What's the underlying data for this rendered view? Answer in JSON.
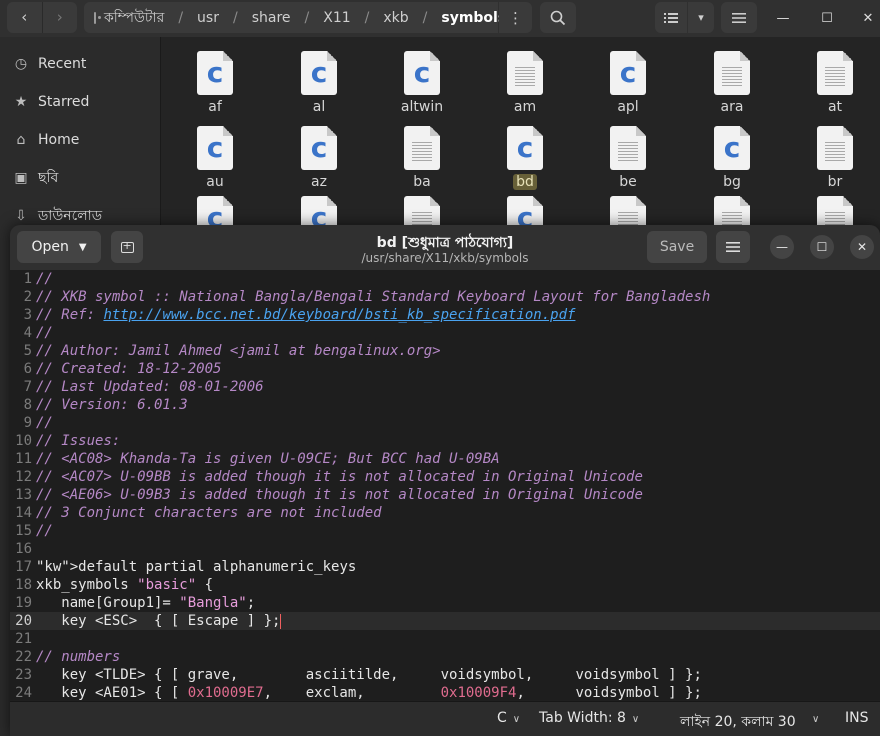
{
  "file_manager": {
    "path": [
      "কম্পিউটার",
      "usr",
      "share",
      "X11",
      "xkb",
      "symbols"
    ],
    "sidebar": [
      {
        "icon": "clock-icon",
        "label": "Recent"
      },
      {
        "icon": "star-icon",
        "label": "Starred"
      },
      {
        "icon": "home-icon",
        "label": "Home"
      },
      {
        "icon": "image-icon",
        "label": "ছবি"
      },
      {
        "icon": "download-icon",
        "label": "ডাউনলোড"
      }
    ],
    "files_row1": [
      {
        "name": "af",
        "type": "c"
      },
      {
        "name": "al",
        "type": "c"
      },
      {
        "name": "altwin",
        "type": "c"
      },
      {
        "name": "am",
        "type": "text"
      },
      {
        "name": "apl",
        "type": "c"
      },
      {
        "name": "ara",
        "type": "text"
      },
      {
        "name": "at",
        "type": "text"
      }
    ],
    "files_row2": [
      {
        "name": "au",
        "type": "c"
      },
      {
        "name": "az",
        "type": "c"
      },
      {
        "name": "ba",
        "type": "text"
      },
      {
        "name": "bd",
        "type": "c",
        "selected": true
      },
      {
        "name": "be",
        "type": "text"
      },
      {
        "name": "bg",
        "type": "c"
      },
      {
        "name": "br",
        "type": "text"
      }
    ]
  },
  "editor": {
    "open_label": "Open",
    "title": "bd [শুধুমাত্র পাঠযোগ্য]",
    "subtitle": "/usr/share/X11/xkb/symbols",
    "save_label": "Save",
    "lines": [
      "//",
      "// XKB symbol :: National Bangla/Bengali Standard Keyboard Layout for Bangladesh",
      "// Ref: http://www.bcc.net.bd/keyboard/bsti_kb_specification.pdf",
      "//",
      "// Author: Jamil Ahmed <jamil at bengalinux.org>",
      "// Created: 18-12-2005",
      "// Last Updated: 08-01-2006",
      "// Version: 6.01.3",
      "//",
      "// Issues:",
      "// <AC08> Khanda-Ta is given U-09CE; But BCC had U-09BA",
      "// <AC07> U-09BB is added though it is not allocated in Original Unicode",
      "// <AE06> U-09B3 is added though it is not allocated in Original Unicode",
      "// 3 Conjunct characters are not included",
      "//",
      "",
      "default partial alphanumeric_keys",
      "xkb_symbols \"basic\" {",
      "   name[Group1]= \"Bangla\";",
      "   key <ESC>  { [ Escape ] };",
      "",
      "// numbers",
      "   key <TLDE> { [ grave,        asciitilde,     voidsymbol,     voidsymbol ] };",
      "   key <AE01> { [ 0x10009E7,    exclam,         0x10009F4,      voidsymbol ] };"
    ],
    "status": {
      "language": "C",
      "tab_width": "Tab Width: 8",
      "position": "লাইন 20, কলাম 30",
      "mode": "INS"
    }
  }
}
